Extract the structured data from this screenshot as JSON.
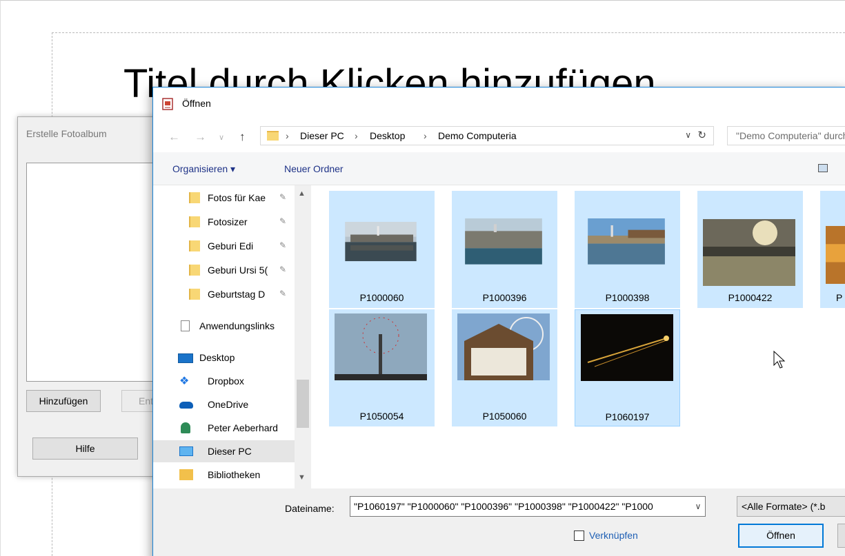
{
  "slide": {
    "title": "Titel durch Klicken hinzufügen"
  },
  "album": {
    "title": "Erstelle Fotoalbum",
    "add_label": "Hinzufügen",
    "remove_label": "Entfernen",
    "help_label": "Hilfe"
  },
  "dialog": {
    "title": "Öffnen",
    "breadcrumb": [
      "Dieser PC",
      "Desktop",
      "Demo Computeria"
    ],
    "search_placeholder": "\"Demo Computeria\" durchsuchen",
    "organize_label": "Organisieren ▾",
    "new_folder_label": "Neuer Ordner",
    "tree": [
      {
        "label": "Fotos für Kae",
        "icon": "folder-icon",
        "pinned": true
      },
      {
        "label": "Fotosizer",
        "icon": "folder-icon",
        "pinned": true
      },
      {
        "label": "Geburi Edi",
        "icon": "folder-icon",
        "pinned": true
      },
      {
        "label": "Geburi Ursi 5(",
        "icon": "folder-icon",
        "pinned": true
      },
      {
        "label": "Geburtstag D",
        "icon": "folder-icon",
        "pinned": true
      },
      {
        "label": "Anwendungslinks",
        "icon": "file-icon",
        "pinned": false
      },
      {
        "label": "Desktop",
        "icon": "desktop-icon",
        "pinned": false
      },
      {
        "label": "Dropbox",
        "icon": "dropbox-icon",
        "pinned": false
      },
      {
        "label": "OneDrive",
        "icon": "onedrive-icon",
        "pinned": false
      },
      {
        "label": "Peter Aeberhard",
        "icon": "user-icon",
        "pinned": false
      },
      {
        "label": "Dieser PC",
        "icon": "pc-icon",
        "pinned": false,
        "selected": true
      },
      {
        "label": "Bibliotheken",
        "icon": "library-icon",
        "pinned": false
      }
    ],
    "files": [
      {
        "name": "P1000060",
        "selected": true
      },
      {
        "name": "P1000396",
        "selected": true
      },
      {
        "name": "P1000398",
        "selected": true
      },
      {
        "name": "P1000422",
        "selected": true
      },
      {
        "name": "P",
        "selected": true
      },
      {
        "name": "P1050054",
        "selected": true
      },
      {
        "name": "P1050060",
        "selected": true
      },
      {
        "name": "P1060197",
        "selected": true,
        "focused": true
      }
    ],
    "filename_label": "Dateiname:",
    "filename_value": "\"P1060197\" \"P1000060\" \"P1000396\" \"P1000398\" \"P1000422\" \"P1000",
    "filetype_value": "<Alle Formate> (*.b",
    "link_label": "Verknüpfen",
    "open_label": "Öffnen"
  }
}
